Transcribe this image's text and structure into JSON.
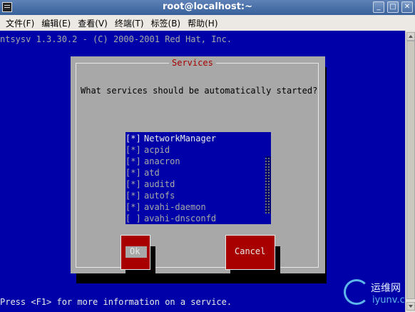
{
  "window": {
    "title": "root@localhost:~",
    "buttons": {
      "minimize": "_",
      "maximize": "□",
      "close": "✕"
    }
  },
  "menubar": {
    "items": [
      "文件(F)",
      "编辑(E)",
      "查看(V)",
      "终端(T)",
      "标签(B)",
      "帮助(H)"
    ]
  },
  "terminal": {
    "header": "ntsysv 1.3.30.2 - (C) 2000-2001 Red Hat, Inc.",
    "footer": "Press <F1> for more information on a service.",
    "colors": {
      "background": "#0000a8",
      "dialog": "#a8a8a8",
      "button": "#a80000"
    }
  },
  "dialog": {
    "title": "Services",
    "question": "What services should be automatically started?",
    "services": [
      {
        "check": "[*]",
        "name": "NetworkManager"
      },
      {
        "check": "[*]",
        "name": "acpid"
      },
      {
        "check": "[*]",
        "name": "anacron"
      },
      {
        "check": "[*]",
        "name": "atd"
      },
      {
        "check": "[*]",
        "name": "auditd"
      },
      {
        "check": "[*]",
        "name": "autofs"
      },
      {
        "check": "[*]",
        "name": "avahi-daemon"
      },
      {
        "check": "[ ]",
        "name": "avahi-dnsconfd"
      }
    ],
    "ok_label": "Ok",
    "cancel_label": "Cancel"
  },
  "watermark": {
    "cn": "运维网",
    "en": "iyunv.com"
  }
}
